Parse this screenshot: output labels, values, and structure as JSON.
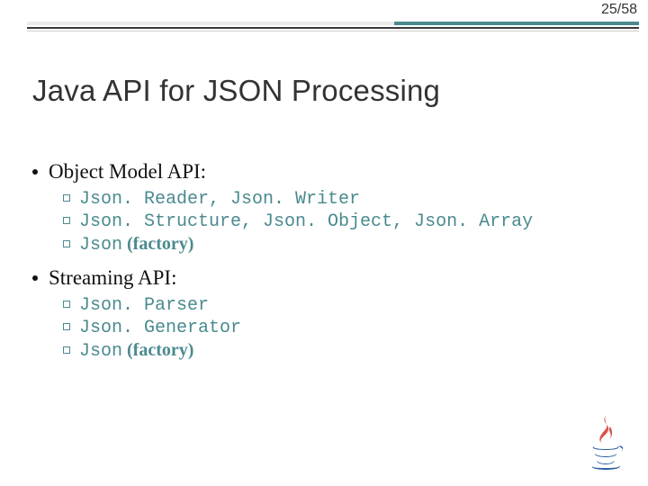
{
  "page": {
    "number": "25/58"
  },
  "title": "Java API for JSON Processing",
  "sections": [
    {
      "heading": "Object Model API:",
      "items": [
        {
          "text": "Json. Reader, Json. Writer",
          "style": "code"
        },
        {
          "text": "Json. Structure, Json. Object, Json. Array",
          "style": "code"
        },
        {
          "prefix": "Json",
          "prefix_style": "code",
          "text": " (factory)",
          "style": "tealbold"
        }
      ]
    },
    {
      "heading": "Streaming API:",
      "items": [
        {
          "text": "Json. Parser",
          "style": "code"
        },
        {
          "text": "Json. Generator",
          "style": "code"
        },
        {
          "prefix": "Json",
          "prefix_style": "code",
          "text": " (factory)",
          "style": "tealbold"
        }
      ]
    }
  ],
  "logo": "java-logo"
}
